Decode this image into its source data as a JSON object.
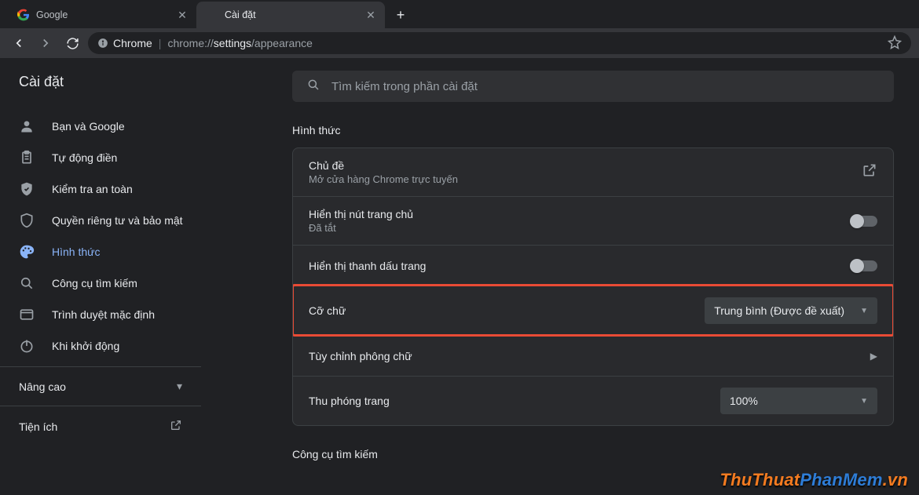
{
  "tabs": [
    {
      "title": "Google"
    },
    {
      "title": "Cài đặt"
    }
  ],
  "toolbar": {
    "secure_label": "Chrome",
    "url_scheme": "chrome://",
    "url_page": "settings",
    "url_sub": "/appearance"
  },
  "page_title": "Cài đặt",
  "search_placeholder": "Tìm kiếm trong phần cài đặt",
  "sidebar": {
    "items": [
      {
        "label": "Bạn và Google"
      },
      {
        "label": "Tự động điền"
      },
      {
        "label": "Kiểm tra an toàn"
      },
      {
        "label": "Quyền riêng tư và bảo mật"
      },
      {
        "label": "Hình thức"
      },
      {
        "label": "Công cụ tìm kiếm"
      },
      {
        "label": "Trình duyệt mặc định"
      },
      {
        "label": "Khi khởi động"
      }
    ],
    "advanced_label": "Nâng cao",
    "extensions_label": "Tiện ích"
  },
  "section": {
    "title": "Hình thức",
    "theme_label": "Chủ đề",
    "theme_sub": "Mở cửa hàng Chrome trực tuyến",
    "home_label": "Hiển thị nút trang chủ",
    "home_sub": "Đã tắt",
    "bookmarks_label": "Hiển thị thanh dấu trang",
    "fontsize_label": "Cỡ chữ",
    "fontsize_value": "Trung bình (Được đề xuất)",
    "customfont_label": "Tùy chỉnh phông chữ",
    "zoom_label": "Thu phóng trang",
    "zoom_value": "100%"
  },
  "next_section_title": "Công cụ tìm kiếm",
  "watermark": {
    "p1": "ThuThuat",
    "p2": "PhanMem",
    "p3": ".vn"
  }
}
